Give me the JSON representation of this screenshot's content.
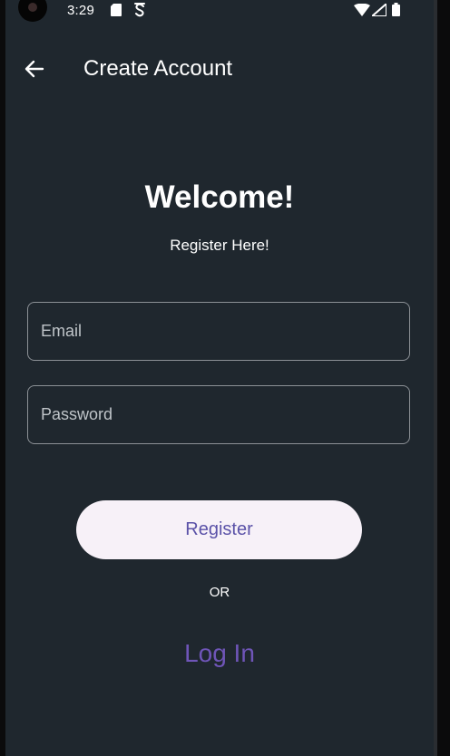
{
  "status_bar": {
    "time": "3:29",
    "icons": [
      "sd-card-icon",
      "s-notification-icon",
      "wifi-icon",
      "signal-icon",
      "battery-icon"
    ]
  },
  "app_bar": {
    "title": "Create Account",
    "back_icon": "arrow-back-icon"
  },
  "main": {
    "heading": "Welcome!",
    "subheading": "Register Here!",
    "email": {
      "placeholder": "Email",
      "value": ""
    },
    "password": {
      "placeholder": "Password",
      "value": ""
    },
    "register_label": "Register",
    "or_label": "OR",
    "login_label": "Log In"
  },
  "colors": {
    "background": "#1f272e",
    "button_bg": "#f7f1f8",
    "button_text": "#5b52a8",
    "link": "#6f55b8",
    "border": "#8c9196"
  }
}
